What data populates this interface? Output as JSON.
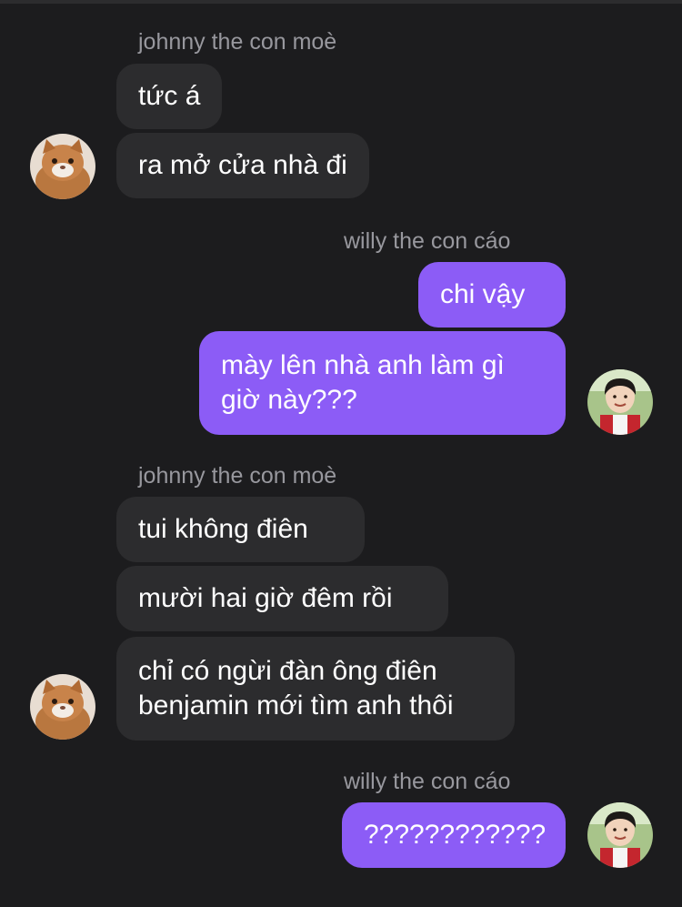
{
  "conversation": {
    "groups": [
      {
        "sender": "johnny the con moè",
        "messages": [
          {
            "lines": [
              "tức á"
            ]
          },
          {
            "lines": [
              "ra mở cửa nhà đi"
            ]
          }
        ]
      },
      {
        "sender": "willy the con cáo",
        "messages": [
          {
            "lines": [
              "chi vậy"
            ]
          },
          {
            "lines": [
              "mày lên nhà anh làm gì",
              "giờ này???"
            ]
          }
        ]
      },
      {
        "sender": "johnny the con moè",
        "messages": [
          {
            "lines": [
              "tui không điên"
            ]
          },
          {
            "lines": [
              "mười hai giờ đêm rồi"
            ]
          },
          {
            "lines": [
              "chỉ có ngừi đàn ông điên",
              "benjamin mới tìm anh thôi"
            ]
          }
        ]
      },
      {
        "sender": "willy the con cáo",
        "messages": [
          {
            "lines": [
              "????????????"
            ]
          }
        ]
      }
    ]
  },
  "colors": {
    "background": "#1c1c1e",
    "incoming_bubble": "#2c2c2e",
    "outgoing_bubble": "#8c5cf6",
    "sender_name": "#98989e",
    "message_text": "#ffffff"
  },
  "icons": {
    "johnny_avatar": "cat-avatar-icon",
    "willy_avatar": "child-avatar-icon"
  }
}
